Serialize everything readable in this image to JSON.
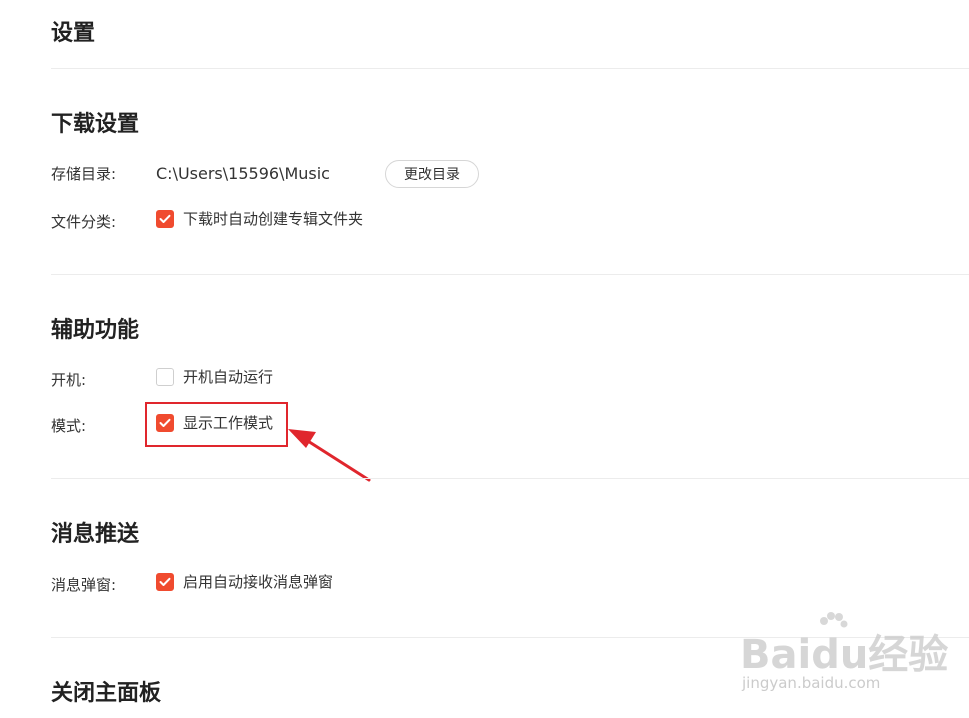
{
  "page": {
    "title": "设置"
  },
  "download": {
    "title": "下载设置",
    "storage_label": "存储目录:",
    "storage_path": "C:\\Users\\15596\\Music",
    "change_button": "更改目录",
    "category_label": "文件分类:",
    "auto_album_folder": {
      "label": "下载时自动创建专辑文件夹",
      "checked": true
    }
  },
  "assist": {
    "title": "辅助功能",
    "startup_label": "开机:",
    "auto_start": {
      "label": "开机自动运行",
      "checked": false
    },
    "mode_label": "模式:",
    "work_mode": {
      "label": "显示工作模式",
      "checked": true
    }
  },
  "messages": {
    "title": "消息推送",
    "popup_label": "消息弹窗:",
    "auto_popup": {
      "label": "启用自动接收消息弹窗",
      "checked": true
    }
  },
  "close_panel": {
    "title": "关闭主面板"
  },
  "watermark": {
    "logo_text": "Baidu经验",
    "url_text": "jingyan.baidu.com"
  },
  "colors": {
    "accent": "#f04b2f",
    "highlight": "#e0262d"
  }
}
